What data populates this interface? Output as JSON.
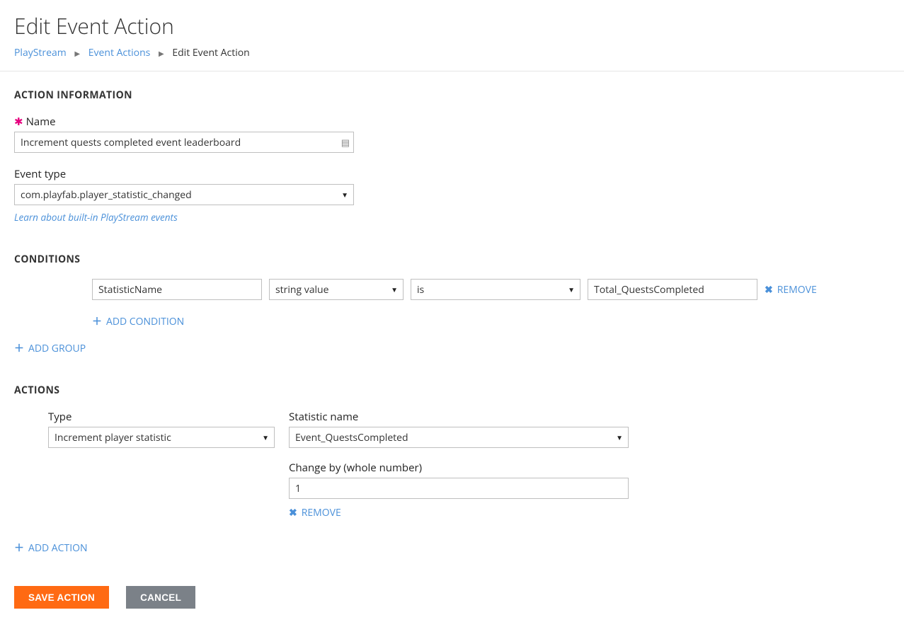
{
  "header": {
    "title": "Edit Event Action",
    "breadcrumb": {
      "items": [
        "PlayStream",
        "Event Actions"
      ],
      "current": "Edit Event Action"
    }
  },
  "action_info": {
    "section_title": "ACTION INFORMATION",
    "name_label": "Name",
    "name_value": "Increment quests completed event leaderboard",
    "event_type_label": "Event type",
    "event_type_value": "com.playfab.player_statistic_changed",
    "learn_link": "Learn about built-in PlayStream events"
  },
  "conditions": {
    "section_title": "CONDITIONS",
    "rows": [
      {
        "field": "StatisticName",
        "value_type": "string value",
        "operator": "is",
        "value": "Total_QuestsCompleted"
      }
    ],
    "remove_label": "REMOVE",
    "add_condition_label": "ADD CONDITION",
    "add_group_label": "ADD GROUP"
  },
  "actions": {
    "section_title": "ACTIONS",
    "type_label": "Type",
    "type_value": "Increment player statistic",
    "stat_name_label": "Statistic name",
    "stat_name_value": "Event_QuestsCompleted",
    "change_by_label": "Change by (whole number)",
    "change_by_value": "1",
    "remove_label": "REMOVE",
    "add_action_label": "ADD ACTION"
  },
  "footer": {
    "save_label": "SAVE ACTION",
    "cancel_label": "CANCEL"
  }
}
